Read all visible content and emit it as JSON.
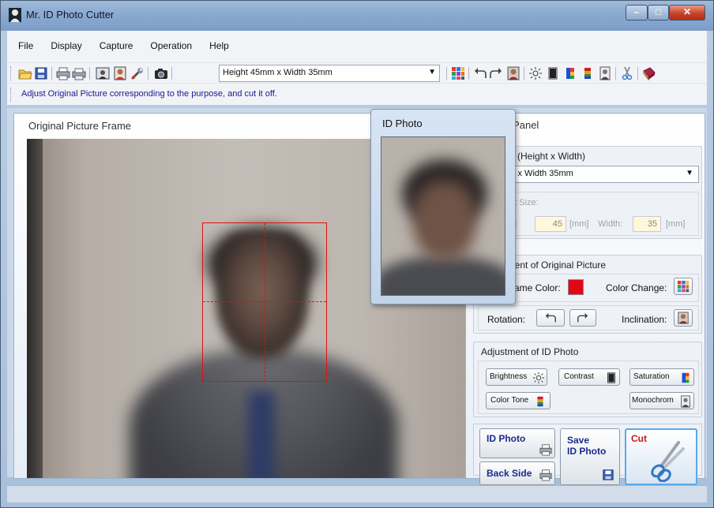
{
  "window": {
    "title": "Mr. ID Photo Cutter"
  },
  "menu": [
    "File",
    "Display",
    "Capture",
    "Operation",
    "Help"
  ],
  "toolbar": {
    "size_select": "Height 45mm x Width 35mm",
    "icons": [
      "open-icon",
      "save-icon",
      "print-icon",
      "print-preview-icon",
      "picture-icon",
      "person-icon",
      "wrench-icon",
      "camera-icon",
      "color-grid-icon",
      "rotate-left-icon",
      "rotate-right-icon",
      "inclination-icon",
      "brightness-icon",
      "contrast-icon",
      "saturation-icon",
      "color-tone-icon",
      "monochrome-icon",
      "scissors-icon",
      "book-icon"
    ]
  },
  "info": {
    "text": "Adjust Original Picture corresponding to the purpose, and cut it off."
  },
  "original_frame": {
    "title": "Original Picture Frame",
    "frame_color": "#e01010"
  },
  "operation_panel": {
    "title": "on Panel",
    "size_group": {
      "label": "e (Height x Width)",
      "selected": "5mm x Width 35mm",
      "print_size_label": "nt Size:",
      "height_label": "ht:",
      "height_value": "45",
      "unit1": "[mm]",
      "width_label": "Width:",
      "width_value": "35",
      "unit2": "[mm]"
    },
    "adjust_original": {
      "label": "nent of Original Picture",
      "frame_color_label": "ame Color:",
      "frame_color_value": "#e30613",
      "color_change_label": "Color Change:",
      "rotation_label": "Rotation:",
      "inclination_label": "Inclination:"
    },
    "adjust_id": {
      "label": "Adjustment of ID Photo",
      "brightness": "Brightness",
      "contrast": "Contrast",
      "saturation": "Saturation",
      "color_tone": "Color Tone",
      "monochrome": "Monochrom"
    },
    "actions": {
      "id_photo": "ID Photo",
      "back_side": "Back Side",
      "save_line1": "Save",
      "save_line2": "ID Photo",
      "cut": "Cut"
    }
  },
  "popup": {
    "title": "ID Photo"
  }
}
